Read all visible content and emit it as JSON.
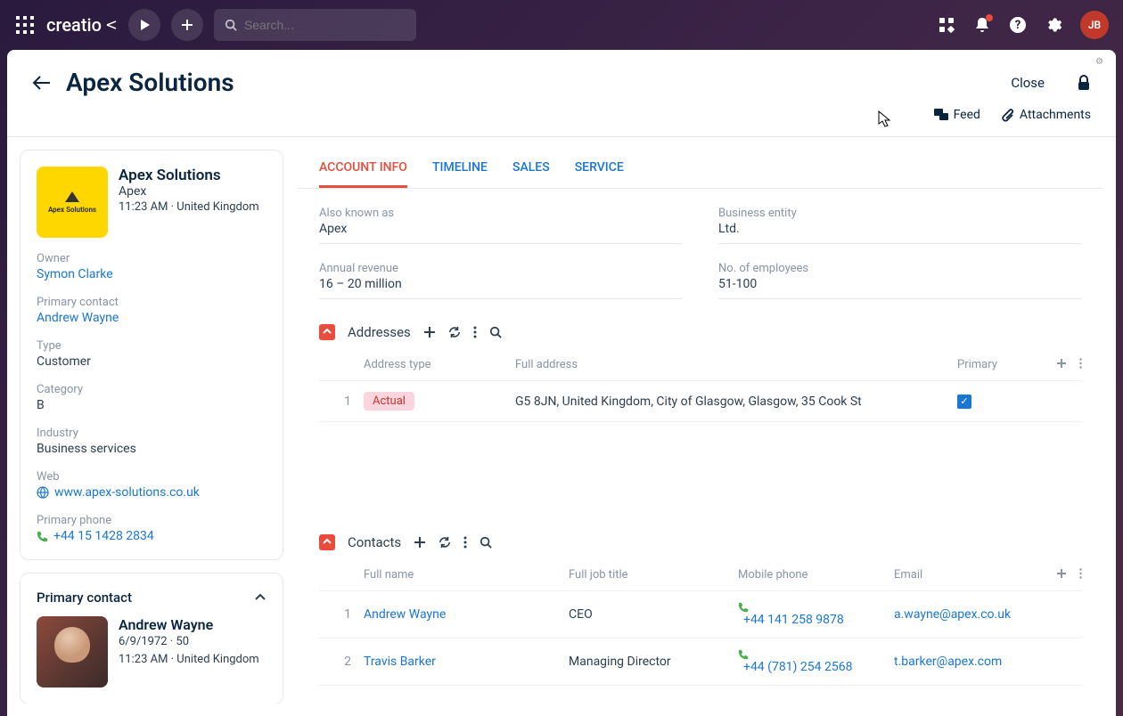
{
  "topnav": {
    "brand": "creatio",
    "search_placeholder": "Search...",
    "avatar_initials": "JB"
  },
  "header": {
    "title": "Apex Solutions",
    "close_label": "Close",
    "feed_label": "Feed",
    "attachments_label": "Attachments"
  },
  "account_card": {
    "name": "Apex Solutions",
    "short": "Apex",
    "time_loc": "11:23 AM · United Kingdom",
    "logo_text": "Apex Solutions"
  },
  "profile_fields": {
    "owner_label": "Owner",
    "owner_value": "Symon Clarke",
    "pc_label": "Primary contact",
    "pc_value": "Andrew Wayne",
    "type_label": "Type",
    "type_value": "Customer",
    "category_label": "Category",
    "category_value": "B",
    "industry_label": "Industry",
    "industry_value": "Business services",
    "web_label": "Web",
    "web_value": "www.apex-solutions.co.uk",
    "phone_label": "Primary phone",
    "phone_value": "+44 15 1428 2834"
  },
  "primary_contact_card": {
    "title": "Primary contact",
    "name": "Andrew Wayne",
    "dob_age": "6/9/1972 · 50",
    "time_loc": "11:23 AM · United Kingdom"
  },
  "tabs": {
    "t0": "ACCOUNT INFO",
    "t1": "TIMELINE",
    "t2": "SALES",
    "t3": "SERVICE"
  },
  "info": {
    "aka_label": "Also known as",
    "aka_value": "Apex",
    "entity_label": "Business entity",
    "entity_value": "Ltd.",
    "revenue_label": "Annual revenue",
    "revenue_value": "16 – 20 million",
    "employees_label": "No. of employees",
    "employees_value": "51-100"
  },
  "addresses": {
    "title": "Addresses",
    "col_type": "Address type",
    "col_addr": "Full address",
    "col_primary": "Primary",
    "rows": [
      {
        "n": "1",
        "type": "Actual",
        "addr": "G5 8JN, United Kingdom, City of Glasgow, Glasgow, 35 Cook St",
        "primary": true
      }
    ]
  },
  "contacts": {
    "title": "Contacts",
    "col_name": "Full name",
    "col_title": "Full job title",
    "col_phone": "Mobile phone",
    "col_email": "Email",
    "rows": [
      {
        "n": "1",
        "name": "Andrew Wayne",
        "title": "CEO",
        "phone": "+44 141 258 9878",
        "email": "a.wayne@apex.co.uk"
      },
      {
        "n": "2",
        "name": "Travis Barker",
        "title": "Managing Director",
        "phone": "+44 (781) 254 2568",
        "email": "t.barker@apex.com"
      }
    ]
  }
}
